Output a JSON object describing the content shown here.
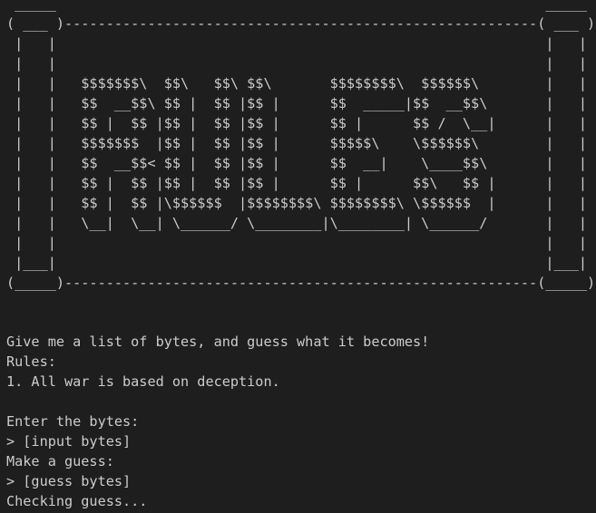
{
  "banner_art": " _____                                                           _____\n( ___ )---------------------------------------------------------( ___ )\n |   |                                                           |   |\n |   |                                                           |   |\n |   |   $$$$$$$\\  $$\\   $$\\ $$\\       $$$$$$$$\\  $$$$$$\\        |   |\n |   |   $$  __$$\\ $$ |  $$ |$$ |      $$  _____|$$  __$$\\       |   |\n |   |   $$ |  $$ |$$ |  $$ |$$ |      $$ |      $$ /  \\__|      |   |\n |   |   $$$$$$$  |$$ |  $$ |$$ |      $$$$$\\    \\$$$$$$\\        |   |\n |   |   $$  __$$< $$ |  $$ |$$ |      $$  __|    \\____$$\\       |   |\n |   |   $$ |  $$ |$$ |  $$ |$$ |      $$ |      $$\\   $$ |      |   |\n |   |   $$ |  $$ |\\$$$$$$  |$$$$$$$$\\ $$$$$$$$\\ \\$$$$$$  |      |   |\n |   |   \\__|  \\__| \\______/ \\________|\\________| \\______/       |   |\n |   |                                                           |   |\n |___|                                                           |___|\n(_____)---------------------------------------------------------(_____)",
  "intro": "Give me a list of bytes, and guess what it becomes!",
  "rules_heading": "Rules:",
  "rule_1": "1. All war is based on deception.",
  "enter_prompt": "Enter the bytes:",
  "input_line": "> [input bytes]",
  "guess_prompt": "Make a guess:",
  "guess_line": "> [guess bytes]",
  "checking": "Checking guess..."
}
